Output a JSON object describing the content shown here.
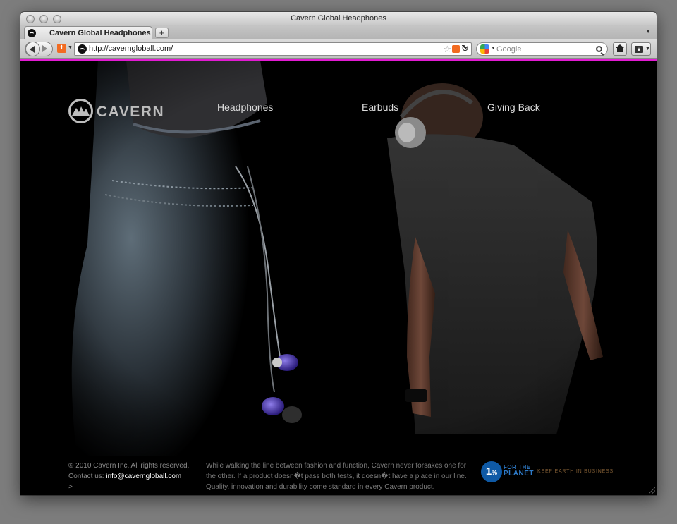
{
  "window": {
    "title": "Cavern Global Headphones"
  },
  "tabs": [
    {
      "label": "Cavern Global Headphones"
    }
  ],
  "toolbar": {
    "new_tab_label": "+",
    "url": "http://caverngloball.com/",
    "search_placeholder": "Google"
  },
  "site": {
    "logo_text": "CAVERN",
    "nav": [
      {
        "label": "Headphones"
      },
      {
        "label": "Earbuds"
      },
      {
        "label": "Giving Back"
      }
    ],
    "footer": {
      "copyright": "© 2010 Cavern Inc. All rights reserved.",
      "contact_prefix": "Contact us:",
      "email": "info@caverngloball.com",
      "arrow": ">",
      "blurb": "While walking the line between fashion and function, Cavern never forsakes one for the other. If a product doesn�t pass both tests, it doesn�t have a place in our line. Quality, innovation and durability come standard in every Cavern product."
    },
    "one_percent": {
      "badge": "1",
      "percent": "%",
      "line1": "FOR THE",
      "line2": "PLANET",
      "tagline": "KEEP EARTH IN BUSINESS"
    }
  },
  "colors": {
    "accent": "#e21bd2",
    "background": "#000000",
    "planet_blue": "#0f5aa6"
  }
}
